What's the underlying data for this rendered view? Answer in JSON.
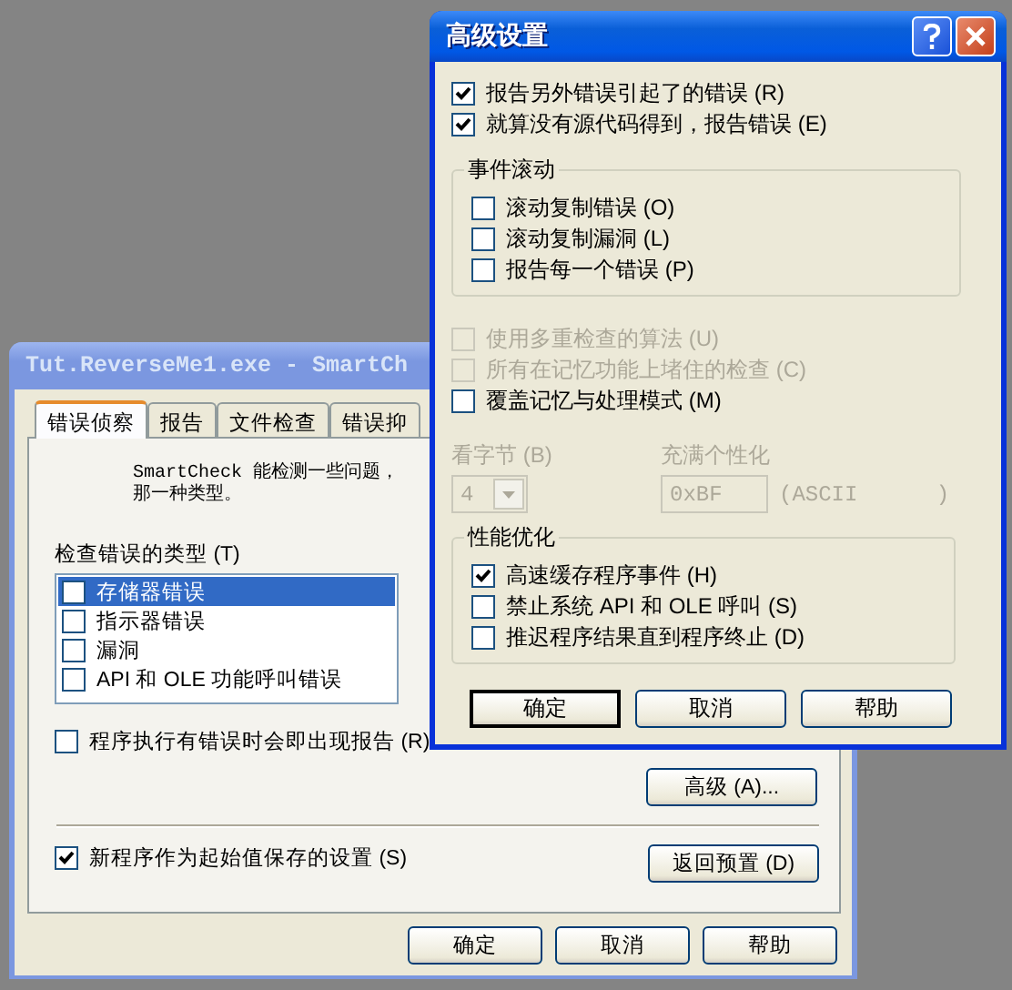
{
  "back_window": {
    "title": "Tut.ReverseMe1.exe - SmartCh",
    "active": false,
    "tabs": [
      {
        "label": "错误侦察",
        "selected": true
      },
      {
        "label": "报告",
        "selected": false
      },
      {
        "label": "文件检查",
        "selected": false
      },
      {
        "label": "错误抑",
        "selected": false
      }
    ],
    "description": [
      "SmartCheck 能检测一些问题，",
      "那一种类型。"
    ],
    "error_types": {
      "label": "检查错误的类型 (T)",
      "items": [
        {
          "label": "存储器错误",
          "checked": false,
          "selected": true
        },
        {
          "label": "指示器错误",
          "checked": false,
          "selected": false
        },
        {
          "label": "漏洞",
          "checked": false,
          "selected": false
        },
        {
          "label": "API 和 OLE 功能呼叫错误",
          "checked": false,
          "selected": false
        }
      ]
    },
    "report_on_error": {
      "label": "程序执行有错误时会即出现报告 (R)",
      "checked": false
    },
    "advanced_button": "高级 (A)...",
    "save_defaults": {
      "label": "新程序作为起始值保存的设置 (S)",
      "checked": true
    },
    "reset_button": "返回预置 (D)",
    "buttons": [
      "确定",
      "取消",
      "帮助"
    ]
  },
  "dialog": {
    "title": "高级设置",
    "active": true,
    "options": [
      {
        "label": "报告另外错误引起了的错误 (R)",
        "checked": true,
        "disabled": false
      },
      {
        "label": "就算没有源代码得到，报告错误 (E)",
        "checked": true,
        "disabled": false
      }
    ],
    "event_scroll": {
      "title": "事件滚动",
      "options": [
        {
          "label": "滚动复制错误 (O)",
          "checked": false,
          "disabled": false
        },
        {
          "label": "滚动复制漏洞 (L)",
          "checked": false,
          "disabled": false
        },
        {
          "label": "报告每一个错误 (P)",
          "checked": false,
          "disabled": false
        }
      ]
    },
    "more_options": [
      {
        "label": "使用多重检查的算法 (U)",
        "checked": false,
        "disabled": true
      },
      {
        "label": "所有在记忆功能上堵住的检查 (C)",
        "checked": false,
        "disabled": true
      },
      {
        "label": "覆盖记忆与处理模式 (M)",
        "checked": false,
        "disabled": false
      }
    ],
    "bytes": {
      "label": "看字节 (B)",
      "value": "4",
      "disabled": true
    },
    "fill": {
      "label": "充满个性化",
      "value": "0xBF",
      "suffix": "(ASCII      )",
      "disabled": true
    },
    "performance": {
      "title": "性能优化",
      "options": [
        {
          "label": "高速缓存程序事件 (H)",
          "checked": true,
          "disabled": false
        },
        {
          "label": "禁止系统 API 和 OLE 呼叫 (S)",
          "checked": false,
          "disabled": false
        },
        {
          "label": "推迟程序结果直到程序终止 (D)",
          "checked": false,
          "disabled": false
        }
      ]
    },
    "buttons": [
      "确定",
      "取消",
      "帮助"
    ]
  }
}
